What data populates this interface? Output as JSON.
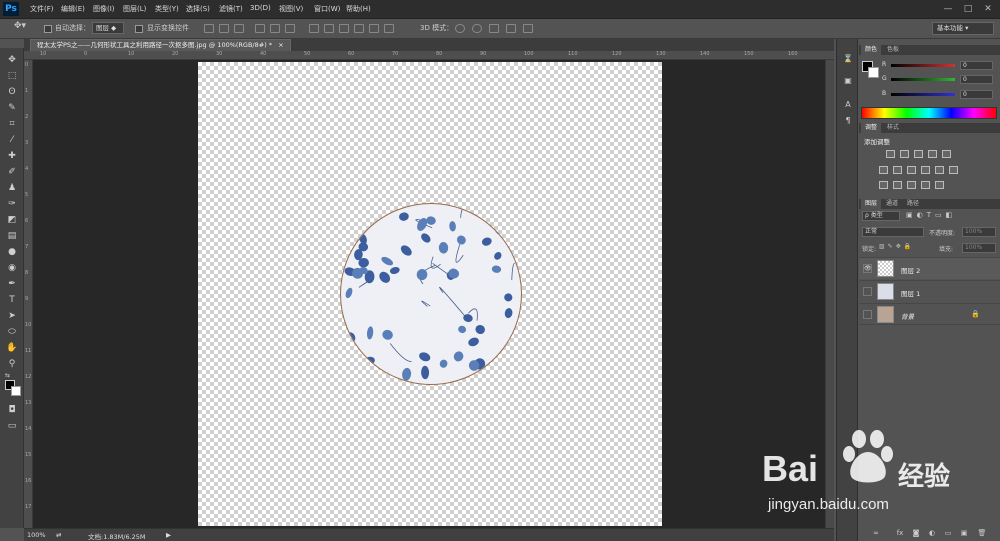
{
  "app": {
    "logo": "Ps"
  },
  "menu": [
    "文件(F)",
    "编辑(E)",
    "图像(I)",
    "图层(L)",
    "类型(Y)",
    "选择(S)",
    "滤镜(T)",
    "3D(D)",
    "视图(V)",
    "窗口(W)",
    "帮助(H)"
  ],
  "window_controls": {
    "minimize": "—",
    "maximize": "□",
    "close": "✕"
  },
  "options": {
    "auto_select_label": "自动选择：",
    "auto_select_value": "图层",
    "show_transform_label": "显示变换控件",
    "mode_3d_label": "3D 模式：",
    "workspace": "基本功能"
  },
  "document": {
    "tab_title": "程太太学PS之——几何形状工具之利用路径一次抠多图.jpg @ 100%(RGB/8#) *",
    "tab_close": "×",
    "zoom": "100%",
    "doc_info": "文档:1.83M/6.25M"
  },
  "ruler": {
    "top": [
      "10",
      "0",
      "10",
      "20",
      "30",
      "40",
      "50",
      "60",
      "70",
      "80",
      "90",
      "100",
      "110",
      "120",
      "130",
      "140",
      "150",
      "160"
    ],
    "left": [
      "0",
      "1",
      "2",
      "3",
      "4",
      "5",
      "6",
      "7",
      "8",
      "9",
      "10",
      "11",
      "12",
      "13",
      "14",
      "15",
      "16",
      "17"
    ]
  },
  "panels": {
    "color": {
      "tabs": [
        "颜色",
        "色板"
      ],
      "channels": [
        {
          "name": "R",
          "value": "0",
          "color": "#d23232"
        },
        {
          "name": "G",
          "value": "0",
          "color": "#32b432"
        },
        {
          "name": "B",
          "value": "0",
          "color": "#3232d2"
        }
      ]
    },
    "adjustments": {
      "tabs": [
        "调整",
        "样式"
      ],
      "title": "添加调整"
    },
    "layers": {
      "tabs": [
        "图层",
        "通道",
        "路径"
      ],
      "filter_kind": "ρ 类型",
      "blend_mode": "正常",
      "opacity_label": "不透明度:",
      "opacity_value": "100%",
      "lock_label": "锁定:",
      "fill_label": "填充:",
      "fill_value": "100%",
      "items": [
        {
          "name": "图层 2",
          "visible": true
        },
        {
          "name": "图层 1",
          "visible": false
        },
        {
          "name": "背景",
          "visible": false,
          "locked": true
        }
      ]
    }
  },
  "watermark": {
    "brand": "Bai",
    "brand_suffix": "经验",
    "url": "jingyan.baidu.com"
  }
}
